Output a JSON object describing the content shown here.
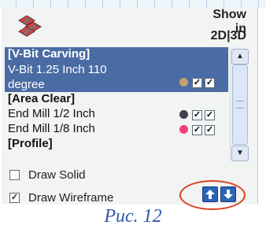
{
  "header": {
    "show_in": "Show in",
    "dims": "2D|3D"
  },
  "list": [
    {
      "type": "group",
      "label": "[V-Bit Carving]",
      "selected": true
    },
    {
      "type": "item",
      "label_line1": "V-Bit 1.25 Inch 110",
      "label_line2": "degree",
      "color": "#c4a06a",
      "checked_2d": true,
      "checked_3d": true,
      "selected": true
    },
    {
      "type": "group",
      "label": "[Area Clear]",
      "selected": false
    },
    {
      "type": "item",
      "label": "End Mill 1/2 Inch",
      "color": "#3f3f52",
      "checked_2d": true,
      "checked_3d": true,
      "selected": false
    },
    {
      "type": "item",
      "label": "End Mill 1/8 Inch",
      "color": "#ef3f79",
      "checked_2d": true,
      "checked_3d": true,
      "selected": false
    },
    {
      "type": "group",
      "label": "[Profile]",
      "selected": false
    }
  ],
  "options": {
    "draw_solid": {
      "label": "Draw Solid",
      "checked": false
    },
    "draw_wireframe": {
      "label": "Draw Wireframe",
      "checked": true
    }
  },
  "icons": {
    "tools": "tools-icon",
    "move_up": "arrow-up-icon",
    "move_down": "arrow-down-icon",
    "scroll_up": "chevron-up-icon",
    "scroll_down": "chevron-down-icon"
  },
  "colors": {
    "selection": "#4a6ba3",
    "button_blue": "#2b63b6",
    "highlight_ring": "#d9411c",
    "caption": "#3058a8"
  },
  "caption": "Рис. 12"
}
